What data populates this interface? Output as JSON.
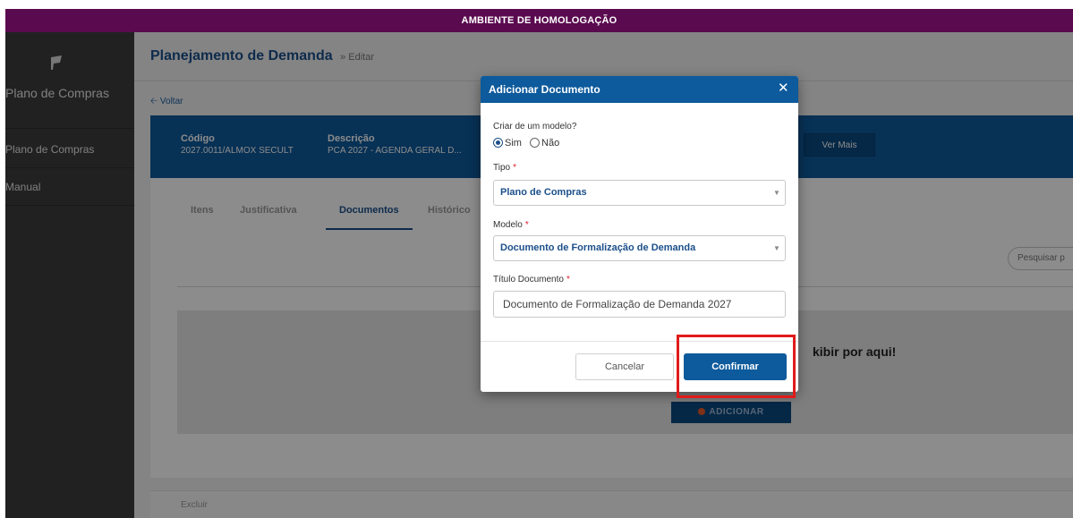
{
  "env_banner": "AMBIENTE DE HOMOLOGAÇÃO",
  "sidebar": {
    "brand": "Plano de Compras",
    "items": [
      {
        "label": "Plano de Compras"
      },
      {
        "label": "Manual"
      }
    ]
  },
  "header": {
    "title": "Planejamento de Demanda",
    "subtitle": "» Editar",
    "back_label": "Voltar"
  },
  "banner": {
    "codigo_label": "Código",
    "codigo_value": "2027.0011/ALMOX SECULT",
    "descricao_label": "Descrição",
    "descricao_value": "PCA 2027 - AGENDA GERAL D...",
    "ver_mais": "Ver Mais"
  },
  "tabs": [
    {
      "label": "Itens"
    },
    {
      "label": "Justificativa"
    },
    {
      "label": "Documentos",
      "active": true
    },
    {
      "label": "Histórico"
    }
  ],
  "search": {
    "placeholder": "Pesquisar p"
  },
  "empty_state": {
    "message": "kibir por aqui!",
    "add_button": "ADICIONAR"
  },
  "footer": {
    "excluir": "Excluir"
  },
  "modal": {
    "title": "Adicionar Documento",
    "close": "✕",
    "modelo_question": "Criar de um modelo?",
    "radio_sim": "Sim",
    "radio_nao": "Não",
    "selected_radio": "Sim",
    "tipo_label": "Tipo",
    "tipo_value": "Plano de Compras",
    "modelo_label": "Modelo",
    "modelo_value": "Documento de Formalização de Demanda",
    "titulo_label": "Título Documento",
    "titulo_value": "Documento de Formalização de Demanda 2027",
    "required_mark": "*",
    "cancel_label": "Cancelar",
    "confirm_label": "Confirmar"
  },
  "colors": {
    "env_bar": "#5a0a4f",
    "sidebar": "#3c3c3c",
    "primary": "#0d5a9c",
    "title_blue": "#1b4f8a",
    "highlight": "#e11b1b"
  }
}
